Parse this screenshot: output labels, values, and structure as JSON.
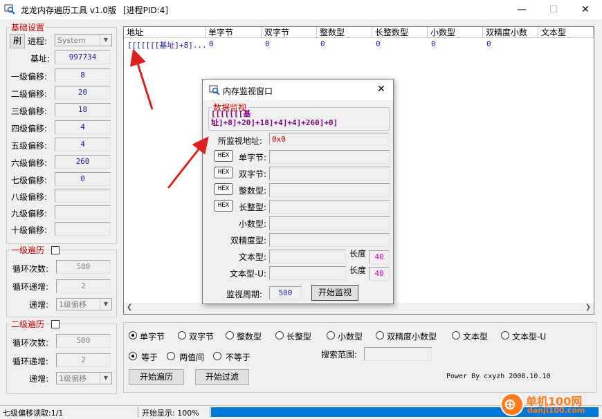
{
  "window": {
    "title": "龙龙内存遍历工具 v1.0版",
    "pid": "[进程PID:4]",
    "minimize_glyph": "—",
    "maximize_glyph": "☐",
    "close_glyph": "✕"
  },
  "basic": {
    "legend": "基础设置",
    "refresh": "刷",
    "process_label": "进程:",
    "process_value": "System",
    "base_label": "基址:",
    "base_value": "997734",
    "offsets": [
      {
        "label": "一级偏移:",
        "value": "8"
      },
      {
        "label": "二级偏移:",
        "value": "20"
      },
      {
        "label": "三级偏移:",
        "value": "18"
      },
      {
        "label": "四级偏移:",
        "value": "4"
      },
      {
        "label": "五级偏移:",
        "value": "4"
      },
      {
        "label": "六级偏移:",
        "value": "260"
      },
      {
        "label": "七级偏移:",
        "value": "0"
      },
      {
        "label": "八级偏移:",
        "value": ""
      },
      {
        "label": "九级偏移:",
        "value": ""
      },
      {
        "label": "十级偏移:",
        "value": ""
      }
    ]
  },
  "traverse1": {
    "legend": "一级遍历",
    "loop_label": "循环次数:",
    "loop_value": "500",
    "inc_label": "循环递增:",
    "inc_value": "2",
    "step_label": "递增:",
    "step_value": "1级偏移"
  },
  "traverse2": {
    "legend": "二级遍历",
    "loop_label": "循环次数:",
    "loop_value": "500",
    "inc_label": "循环递增:",
    "inc_value": "2",
    "step_label": "递增:",
    "step_value": "1级偏移"
  },
  "table": {
    "columns": [
      "地址",
      "单字节",
      "双字节",
      "整数型",
      "长整数型",
      "小数型",
      "双精度小数",
      "文本型"
    ],
    "row": [
      "[[[[[[[基址]+8]...",
      "0",
      "0",
      "0",
      "0",
      "0",
      "0",
      ""
    ]
  },
  "dialog": {
    "title": "内存监视窗口",
    "close_glyph": "✕",
    "group": "数据监视",
    "expression": "[[[[[[[基址]+8]+20]+18]+4]+4]+260]+0]",
    "expr_line1": "[[[[[[[基",
    "expr_line2": "址]+8]+20]+18]+4]+4]+260]+0]",
    "addr_label": "所监视地址:",
    "addr_value": "0x0",
    "hex": "HEX",
    "fields": [
      "单字节:",
      "双字节:",
      "整数型:",
      "长整型:",
      "小数型:",
      "双精度型:",
      "文本型:",
      "文本型-U:"
    ],
    "len_label": "长度",
    "len_value": "40",
    "period_label": "监视周期:",
    "period_value": "500",
    "start_button": "开始监视"
  },
  "search": {
    "types": [
      "单字节",
      "双字节",
      "整数型",
      "长整型",
      "小数型",
      "双精度小数型",
      "文本型",
      "文本型-U"
    ],
    "selected_type": "单字节",
    "compare": [
      "等于",
      "两值间",
      "不等于"
    ],
    "selected_compare": "等于",
    "range_label": "搜索范围:",
    "range_value": "",
    "btn_traverse": "开始遍历",
    "btn_filter": "开始过滤",
    "credit": "Power By cxyzh 2008.10.10"
  },
  "status": {
    "left": "七级偏移读取:1/1",
    "mid": "开始显示: 100%",
    "progress": 1.0
  },
  "watermark": {
    "cn": "单机100网",
    "url": "danji100.com"
  },
  "colors": {
    "legend_red": "#d00000",
    "value_blue": "#1a1aa0",
    "expr_purple": "#800080",
    "len_magenta": "#cc00cc",
    "progress_blue": "#0078d7",
    "arrow_red": "#e02020"
  }
}
